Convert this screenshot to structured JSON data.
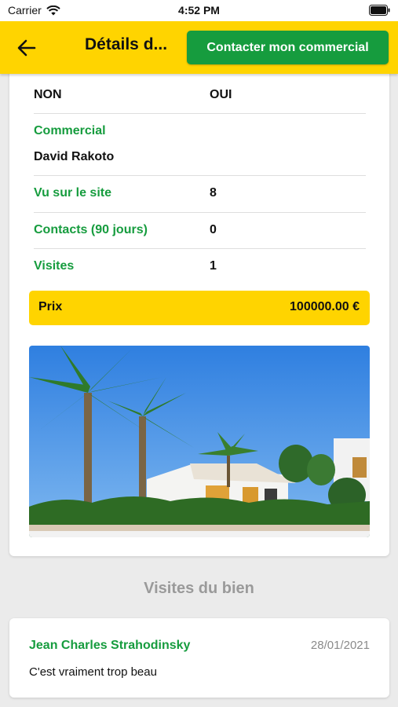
{
  "status_bar": {
    "carrier": "Carrier",
    "time": "4:52 PM"
  },
  "app_bar": {
    "title": "Détails d...",
    "contact_button": "Contacter mon commercial",
    "back_icon": "arrow-left-icon"
  },
  "details": {
    "top_row": {
      "left": "NON",
      "right": "OUI"
    },
    "commercial": {
      "label": "Commercial",
      "value": "David Rakoto"
    },
    "vu_sur_le_site": {
      "label": "Vu sur le site",
      "value": "8"
    },
    "contacts": {
      "label": "Contacts (90 jours)",
      "value": "0"
    },
    "visites": {
      "label": "Visites",
      "value": "1"
    },
    "price": {
      "label": "Prix",
      "value": "100000.00 €"
    }
  },
  "section": {
    "visits_title": "Visites du bien"
  },
  "visits": [
    {
      "name": "Jean Charles Strahodinsky",
      "date": "28/01/2021",
      "comment": "C'est vraiment trop beau"
    }
  ],
  "colors": {
    "accent_yellow": "#ffd400",
    "accent_green": "#169c3e",
    "background": "#ebebeb"
  }
}
